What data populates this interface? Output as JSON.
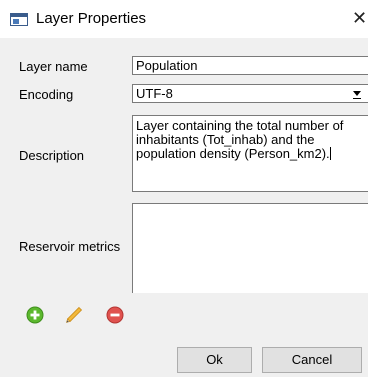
{
  "window": {
    "title": "Layer Properties",
    "close_glyph": "✕",
    "icon": "layer-properties-icon"
  },
  "form": {
    "layer_name": {
      "label": "Layer name",
      "value": "Population"
    },
    "encoding": {
      "label": "Encoding",
      "value": "UTF-8"
    },
    "description": {
      "label": "Description",
      "value": "Layer containing the total number of inhabitants (Tot_inhab) and the population density (Person_km2)."
    },
    "reservoir_metrics": {
      "label": "Reservoir metrics",
      "value": ""
    }
  },
  "toolbar": {
    "add_icon": "plus-circle-icon",
    "edit_icon": "pencil-icon",
    "remove_icon": "minus-circle-icon"
  },
  "buttons": {
    "ok_label": "Ok",
    "cancel_label": "Cancel"
  },
  "colors": {
    "add_green": "#5cb82e",
    "remove_red": "#e0524f",
    "pencil_yellow": "#f2b83a"
  }
}
